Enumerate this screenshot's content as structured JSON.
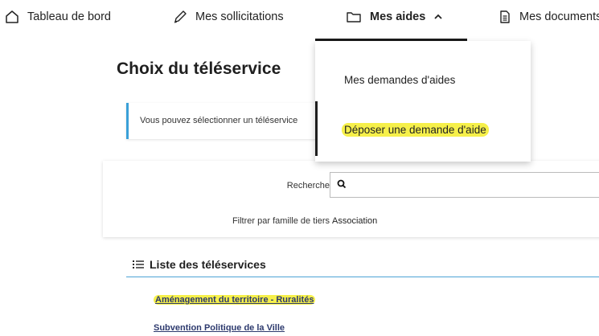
{
  "nav": {
    "dashboard": "Tableau de bord",
    "solicitations": "Mes sollicitations",
    "aides": "Mes aides",
    "documents": "Mes documents"
  },
  "dropdown": {
    "items": [
      "Mes demandes d'aides",
      "Déposer une demande d'aide"
    ]
  },
  "page": {
    "title": "Choix du téléservice",
    "info": "Vous pouvez sélectionner un téléservice"
  },
  "filters": {
    "search_label": "Recherche",
    "family_label": "Filtrer par famille de tiers",
    "family_value": "Association"
  },
  "list": {
    "title": "Liste des téléservices",
    "items": [
      "Aménagement du territoire - Ruralités",
      "Subvention Politique de la Ville"
    ]
  },
  "colors": {
    "accent": "#3aa0d8",
    "highlight": "#f6f04a",
    "link": "#2d3a6e"
  },
  "icons": [
    "home-icon",
    "pen-icon",
    "folder-icon",
    "chevron-up-icon",
    "document-icon",
    "search-icon",
    "list-icon"
  ]
}
